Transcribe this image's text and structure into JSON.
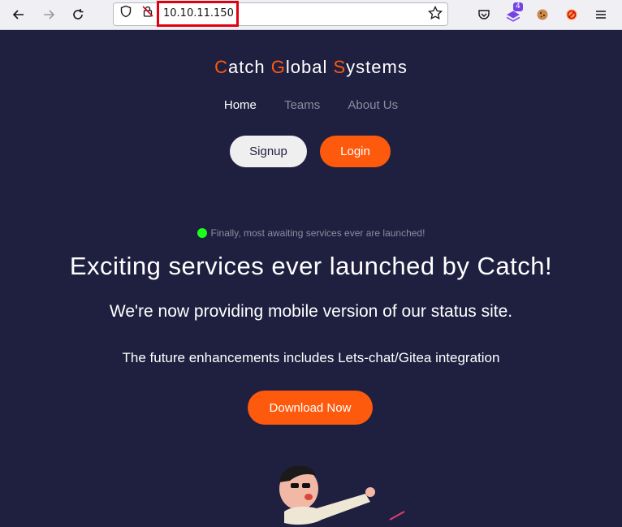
{
  "browser": {
    "url": "10.10.11.150",
    "icons": [
      "back-arrow-icon",
      "forward-arrow-icon",
      "reload-icon",
      "shield-icon",
      "insecure-lock-icon",
      "bookmark-star-icon",
      "pocket-icon",
      "extension-icon",
      "cookie-icon",
      "blocked-icon",
      "menu-icon"
    ],
    "extension_badge": "4"
  },
  "site": {
    "brand": {
      "c": "C",
      "atch": "atch ",
      "g": "G",
      "lobal": "lobal ",
      "s": "S",
      "ystems": "ystems"
    },
    "nav": {
      "home": "Home",
      "teams": "Teams",
      "about": "About Us"
    },
    "signup": "Signup",
    "login": "Login",
    "status_text": "Finally, most awaiting services ever are launched!",
    "headline": "Exciting services ever launched by Catch!",
    "subheadline": "We're now providing mobile version of our status site.",
    "tagline": "The future enhancements includes Lets-chat/Gitea integration",
    "download": "Download Now"
  },
  "colors": {
    "background": "#1f1f40",
    "accent": "#fd5a0d",
    "status_dot": "#1bff1b"
  }
}
